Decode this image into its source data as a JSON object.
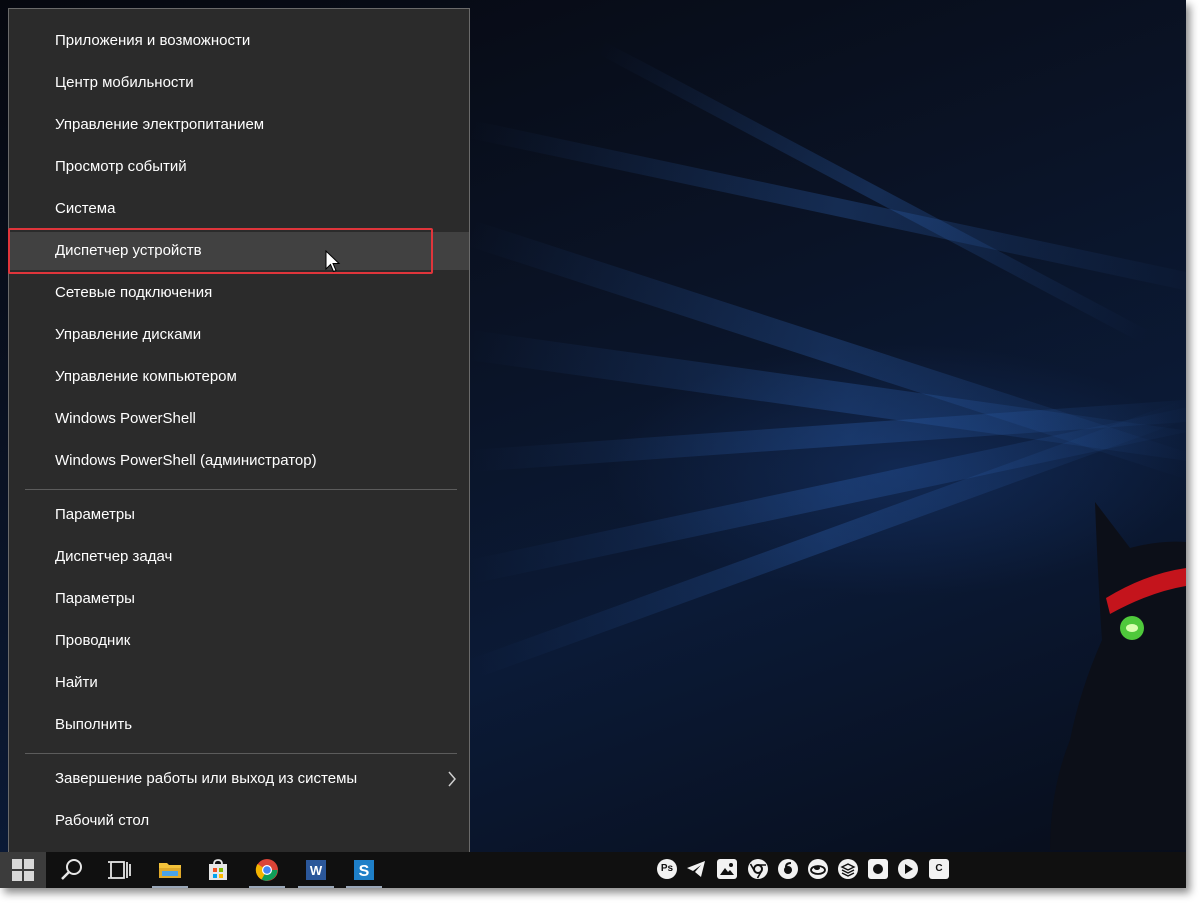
{
  "menu": {
    "group1": [
      {
        "label": "Приложения и возможности"
      },
      {
        "label": "Центр мобильности"
      },
      {
        "label": "Управление электропитанием"
      },
      {
        "label": "Просмотр событий"
      },
      {
        "label": "Система"
      },
      {
        "label": "Диспетчер устройств",
        "highlighted": true
      },
      {
        "label": "Сетевые подключения"
      },
      {
        "label": "Управление дисками"
      },
      {
        "label": "Управление компьютером"
      },
      {
        "label": "Windows PowerShell"
      },
      {
        "label": "Windows PowerShell (администратор)"
      }
    ],
    "group2": [
      {
        "label": "Параметры"
      },
      {
        "label": "Диспетчер задач"
      },
      {
        "label": "Параметры"
      },
      {
        "label": "Проводник"
      },
      {
        "label": "Найти"
      },
      {
        "label": "Выполнить"
      }
    ],
    "group3": [
      {
        "label": "Завершение работы или выход из системы",
        "has_submenu": true,
        "submenu_icon": "chevron-right-icon"
      },
      {
        "label": "Рабочий стол"
      }
    ]
  },
  "highlight_color": "#e0353b",
  "taskbar": {
    "pinned": [
      {
        "icon": "windows-start-icon"
      },
      {
        "icon": "search-icon"
      },
      {
        "icon": "task-view-icon"
      },
      {
        "icon": "file-explorer-icon"
      },
      {
        "icon": "store-icon"
      },
      {
        "icon": "chrome-icon"
      },
      {
        "icon": "word-icon",
        "label": "W"
      },
      {
        "icon": "snagit-icon",
        "label": "S"
      }
    ],
    "tray": [
      {
        "icon": "photoshop-icon",
        "label": "Ps"
      },
      {
        "icon": "telegram-icon"
      },
      {
        "icon": "photos-icon"
      },
      {
        "icon": "chrome-tray-icon"
      },
      {
        "icon": "music-icon"
      },
      {
        "icon": "cloud-icon"
      },
      {
        "icon": "layers-icon"
      },
      {
        "icon": "camera-icon"
      },
      {
        "icon": "play-icon"
      },
      {
        "icon": "c-app-icon",
        "label": "C"
      }
    ]
  }
}
